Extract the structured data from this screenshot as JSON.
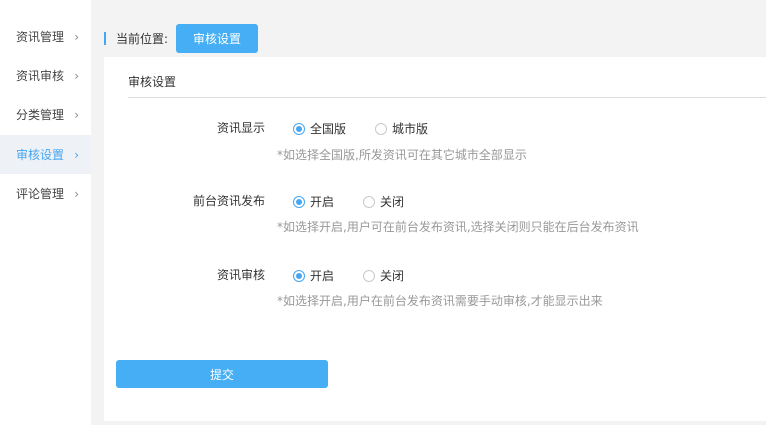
{
  "sidebar": {
    "items": [
      {
        "label": "资讯管理",
        "chevron": "›"
      },
      {
        "label": "资讯审核",
        "chevron": "›"
      },
      {
        "label": "分类管理",
        "chevron": "›"
      },
      {
        "label": "审核设置",
        "chevron": "›",
        "active": true
      },
      {
        "label": "评论管理",
        "chevron": "›"
      }
    ]
  },
  "breadcrumb": {
    "prefix": "当前位置:",
    "current": "审核设置"
  },
  "panel": {
    "title": "审核设置",
    "settings": [
      {
        "label": "资讯显示",
        "options": [
          {
            "label": "全国版",
            "checked": true
          },
          {
            "label": "城市版",
            "checked": false
          }
        ],
        "hint": "*如选择全国版,所发资讯可在其它城市全部显示"
      },
      {
        "label": "前台资讯发布",
        "options": [
          {
            "label": "开启",
            "checked": true
          },
          {
            "label": "关闭",
            "checked": false
          }
        ],
        "hint": "*如选择开启,用户可在前台发布资讯,选择关闭则只能在后台发布资讯"
      },
      {
        "label": "资讯审核",
        "options": [
          {
            "label": "开启",
            "checked": true
          },
          {
            "label": "关闭",
            "checked": false
          }
        ],
        "hint": "*如选择开启,用户在前台发布资讯需要手动审核,才能显示出来"
      }
    ],
    "submit_label": "提交"
  },
  "colors": {
    "accent": "#46a6f2",
    "button": "#46aef4",
    "background": "#f3f3f3",
    "hint_text": "#999999"
  }
}
